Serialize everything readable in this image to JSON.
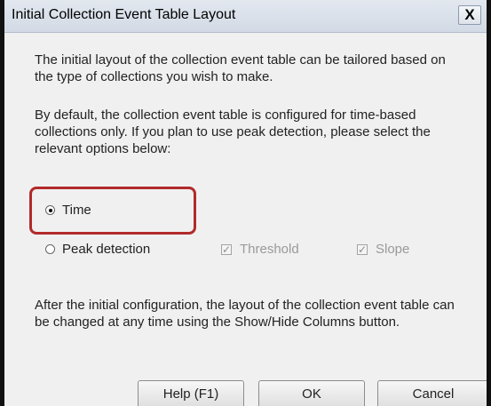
{
  "dialog": {
    "title": "Initial Collection Event Table Layout",
    "close_label": "X"
  },
  "body": {
    "paragraph1": "The initial layout of the collection event table can be tailored based on the type of collections you wish to make.",
    "paragraph2": "By default, the collection event table is configured for time-based collections only. If you plan to use peak detection, please select the relevant options below:",
    "paragraph3": "After the initial configuration, the layout of the collection event table can be changed at any time using the Show/Hide Columns button."
  },
  "options": {
    "time_label": "Time",
    "time_selected": true,
    "peak_label": "Peak detection",
    "peak_selected": false,
    "threshold_label": "Threshold",
    "threshold_checked": true,
    "threshold_enabled": false,
    "slope_label": "Slope",
    "slope_checked": true,
    "slope_enabled": false
  },
  "buttons": {
    "help_label": "Help (F1)",
    "ok_label": "OK",
    "cancel_label": "Cancel"
  },
  "colors": {
    "highlight": "#b22a2a"
  }
}
